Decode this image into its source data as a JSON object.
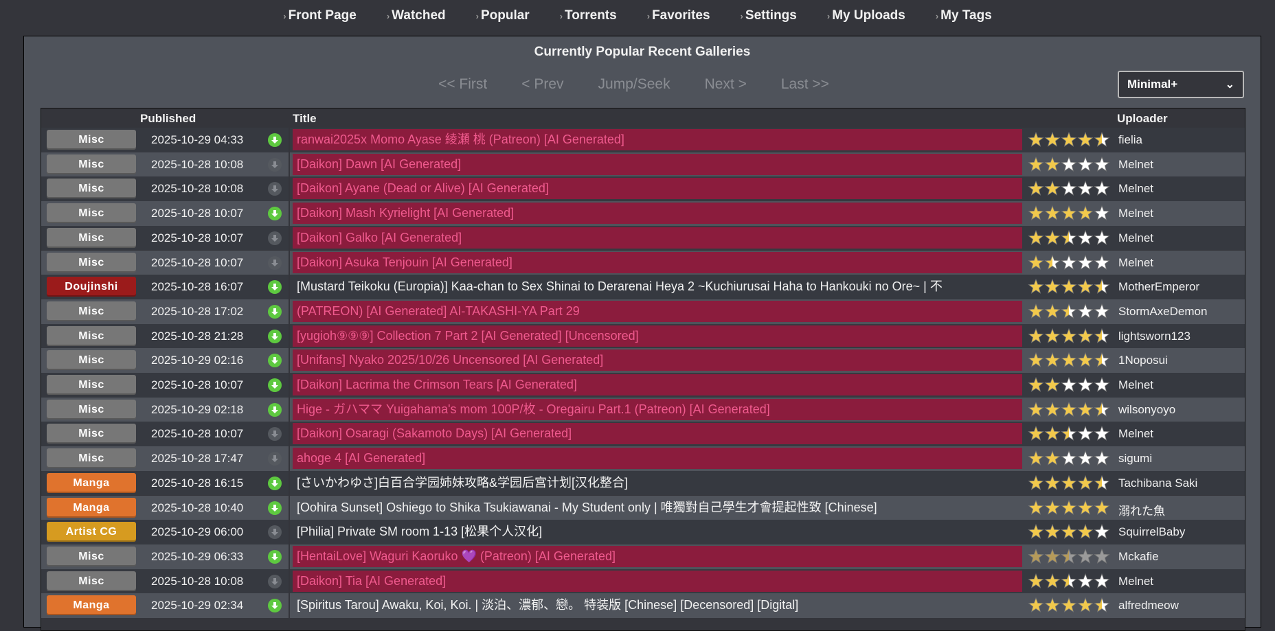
{
  "nav": [
    "Front Page",
    "Watched",
    "Popular",
    "Torrents",
    "Favorites",
    "Settings",
    "My Uploads",
    "My Tags"
  ],
  "panel_title": "Currently Popular Recent Galleries",
  "pager": [
    "<< First",
    "< Prev",
    "Jump/Seek",
    "Next >",
    "Last >>"
  ],
  "mode": "Minimal+",
  "headers": {
    "published": "Published",
    "title": "Title",
    "uploader": "Uploader"
  },
  "colors": {
    "Misc": "#777777",
    "Doujinshi": "#9b1b1b",
    "Manga": "#e0732d",
    "Artist CG": "#d69b20",
    "highlight_bg": "#8b1c3d",
    "highlight_text": "#f05a8e",
    "star": "#f2c94c"
  },
  "rows": [
    {
      "cat": "Misc",
      "date": "2025-10-29 04:33",
      "dl": true,
      "title": "ranwai2025x Momo Ayase 綾瀬 桃 (Patreon) [AI Generated]",
      "hl": true,
      "rating": 4.5,
      "dim": false,
      "uploader": "fielia"
    },
    {
      "cat": "Misc",
      "date": "2025-10-28 10:08",
      "dl": false,
      "title": "[Daikon] Dawn [AI Generated]",
      "hl": true,
      "rating": 2,
      "dim": false,
      "uploader": "Melnet"
    },
    {
      "cat": "Misc",
      "date": "2025-10-28 10:08",
      "dl": false,
      "title": "[Daikon] Ayane (Dead or Alive) [AI Generated]",
      "hl": true,
      "rating": 2,
      "dim": false,
      "uploader": "Melnet"
    },
    {
      "cat": "Misc",
      "date": "2025-10-28 10:07",
      "dl": true,
      "title": "[Daikon] Mash Kyrielight [AI Generated]",
      "hl": true,
      "rating": 4,
      "dim": false,
      "uploader": "Melnet"
    },
    {
      "cat": "Misc",
      "date": "2025-10-28 10:07",
      "dl": false,
      "title": "[Daikon] Galko [AI Generated]",
      "hl": true,
      "rating": 2.5,
      "dim": false,
      "uploader": "Melnet"
    },
    {
      "cat": "Misc",
      "date": "2025-10-28 10:07",
      "dl": false,
      "title": "[Daikon] Asuka Tenjouin [AI Generated]",
      "hl": true,
      "rating": 1.5,
      "dim": false,
      "uploader": "Melnet"
    },
    {
      "cat": "Doujinshi",
      "date": "2025-10-28 16:07",
      "dl": true,
      "title": "[Mustard Teikoku (Europia)] Kaa-chan to Sex Shinai to Derarenai Heya 2 ~Kuchiurusai Haha to Hankouki no Ore~ | 不",
      "hl": false,
      "rating": 4.5,
      "dim": false,
      "uploader": "MotherEmperor"
    },
    {
      "cat": "Misc",
      "date": "2025-10-28 17:02",
      "dl": true,
      "title": "(PATREON) [AI Generated] AI-TAKASHI-YA Part 29",
      "hl": true,
      "rating": 2.5,
      "dim": false,
      "uploader": "StormAxeDemon"
    },
    {
      "cat": "Misc",
      "date": "2025-10-28 21:28",
      "dl": true,
      "title": "[yugioh⑨⑨⑨] Collection 7 Part 2 [AI Generated] [Uncensored]",
      "hl": true,
      "rating": 4.5,
      "dim": false,
      "uploader": "lightsworn123"
    },
    {
      "cat": "Misc",
      "date": "2025-10-29 02:16",
      "dl": true,
      "title": "[Unifans] Nyako 2025/10/26 Uncensored [AI Generated]",
      "hl": true,
      "rating": 4.5,
      "dim": false,
      "uploader": "1Noposui"
    },
    {
      "cat": "Misc",
      "date": "2025-10-28 10:07",
      "dl": true,
      "title": "[Daikon] Lacrima the Crimson Tears [AI Generated]",
      "hl": true,
      "rating": 2,
      "dim": false,
      "uploader": "Melnet"
    },
    {
      "cat": "Misc",
      "date": "2025-10-29 02:18",
      "dl": true,
      "title": "Hige - ガハママ Yuigahama's mom 100P/枚 - Oregairu Part.1 (Patreon) [AI Generated]",
      "hl": true,
      "rating": 4.5,
      "dim": false,
      "uploader": "wilsonyoyo"
    },
    {
      "cat": "Misc",
      "date": "2025-10-28 10:07",
      "dl": false,
      "title": "[Daikon] Osaragi (Sakamoto Days) [AI Generated]",
      "hl": true,
      "rating": 2.5,
      "dim": false,
      "uploader": "Melnet"
    },
    {
      "cat": "Misc",
      "date": "2025-10-28 17:47",
      "dl": false,
      "title": "ahoge 4 [AI Generated]",
      "hl": true,
      "rating": 2,
      "dim": false,
      "uploader": "sigumi"
    },
    {
      "cat": "Manga",
      "date": "2025-10-28 16:15",
      "dl": true,
      "title": "[さいかわゆさ]白百合学园姉妹攻略&学园后宫计划[汉化整合]",
      "hl": false,
      "rating": 4.5,
      "dim": false,
      "uploader": "Tachibana Saki"
    },
    {
      "cat": "Manga",
      "date": "2025-10-28 10:40",
      "dl": true,
      "title": "[Oohira Sunset] Oshiego to Shika Tsukiawanai - My Student only | 唯獨對自己學生才會提起性致 [Chinese]",
      "hl": false,
      "rating": 5,
      "dim": false,
      "uploader": "溺れた魚"
    },
    {
      "cat": "Artist CG",
      "date": "2025-10-29 06:00",
      "dl": false,
      "title": "[Philia] Private SM room 1-13 [松果个人汉化]",
      "hl": false,
      "rating": 4,
      "dim": false,
      "uploader": "SquirrelBaby"
    },
    {
      "cat": "Misc",
      "date": "2025-10-29 06:33",
      "dl": true,
      "title": "[HentaiLove] Waguri Kaoruko 💜 (Patreon) [AI Generated]",
      "hl": true,
      "rating": 2.5,
      "dim": true,
      "uploader": "Mckafie"
    },
    {
      "cat": "Misc",
      "date": "2025-10-28 10:08",
      "dl": false,
      "title": "[Daikon] Tia [AI Generated]",
      "hl": true,
      "rating": 2.5,
      "dim": false,
      "uploader": "Melnet"
    },
    {
      "cat": "Manga",
      "date": "2025-10-29 02:34",
      "dl": true,
      "title": "[Spiritus Tarou] Awaku, Koi, Koi. | 淡泊、濃郁、戀。 特装版 [Chinese] [Decensored] [Digital]",
      "hl": false,
      "rating": 4.5,
      "dim": false,
      "uploader": "alfredmeow"
    }
  ]
}
